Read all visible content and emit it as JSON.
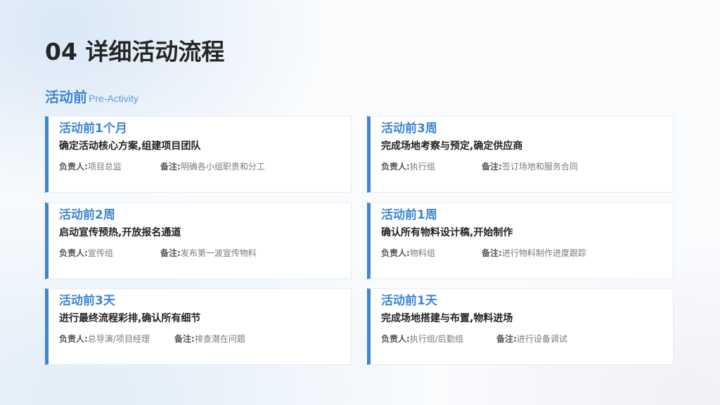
{
  "page": {
    "title": "04 详细活动流程"
  },
  "section": {
    "title": "活动前",
    "subtitle": "Pre-Activity"
  },
  "labels": {
    "owner": "负责人:",
    "note": "备注:"
  },
  "cards": [
    {
      "title": "活动前1个月",
      "task": "确定活动核心方案,组建项目团队",
      "owner": "项目总监",
      "note": "明确各小组职责和分工"
    },
    {
      "title": "活动前3周",
      "task": "完成场地考察与预定,确定供应商",
      "owner": "执行组",
      "note": "签订场地和服务合同"
    },
    {
      "title": "活动前2周",
      "task": "启动宣传预热,开放报名通道",
      "owner": "宣传组",
      "note": "发布第一波宣传物料"
    },
    {
      "title": "活动前1周",
      "task": "确认所有物料设计稿,开始制作",
      "owner": "物料组",
      "note": "进行物料制作进度跟踪"
    },
    {
      "title": "活动前3天",
      "task": "进行最终流程彩排,确认所有细节",
      "owner": "总导演/项目经理",
      "note": "排查潜在问题"
    },
    {
      "title": "活动前1天",
      "task": "完成场地搭建与布置,物料进场",
      "owner": "执行组/后勤组",
      "note": "进行设备调试"
    }
  ],
  "colors": {
    "accent": "#3f86cf",
    "title_text": "#262626",
    "card_border": "#e6ecf2"
  }
}
